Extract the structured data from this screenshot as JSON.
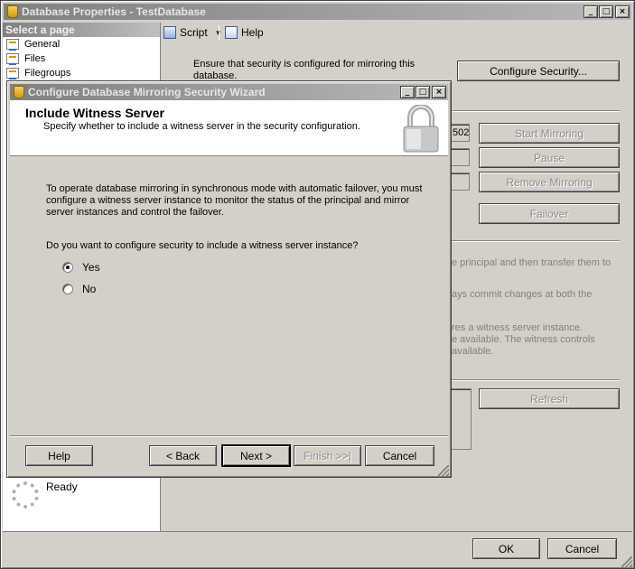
{
  "main_window": {
    "title": "Database Properties - TestDatabase",
    "title_buttons": [
      "_",
      "□",
      "×"
    ]
  },
  "toolbar": {
    "script_label": "Script",
    "help_label": "Help"
  },
  "page_list": {
    "header": "Select a page",
    "items": [
      {
        "label": "General"
      },
      {
        "label": "Files"
      },
      {
        "label": "Filegroups"
      }
    ]
  },
  "progress": {
    "status": "Ready"
  },
  "mirroring": {
    "security_note": "Ensure that security is configured for mirroring this database.",
    "configure_security": "Configure Security...",
    "port_fragment": "502",
    "start_mirroring": "Start Mirroring",
    "pause": "Pause",
    "remove_mirroring": "Remove Mirroring",
    "failover": "Failover",
    "refresh": "Refresh",
    "desc_frag_1": "e principal and then transfer them to",
    "desc_frag_2": "ays commit changes at both the",
    "desc_frag_3": "res a witness server instance.",
    "desc_frag_4": "e available. The witness controls",
    "desc_frag_5": "available."
  },
  "main_buttons": {
    "ok": "OK",
    "cancel": "Cancel"
  },
  "wizard": {
    "title": "Configure Database Mirroring Security Wizard",
    "heading": "Include Witness Server",
    "subheading": "Specify whether to include a witness server in the security configuration.",
    "paragraph": "To operate database mirroring in synchronous mode with automatic failover, you must configure a witness server instance to monitor the status of the principal and mirror server instances and control the failover.",
    "question": "Do you want to configure security to include a witness server instance?",
    "option_yes": "Yes",
    "option_no": "No",
    "selected": "Yes",
    "buttons": {
      "help": "Help",
      "back": "< Back",
      "next": "Next >",
      "finish": "Finish >>|",
      "cancel": "Cancel"
    }
  }
}
